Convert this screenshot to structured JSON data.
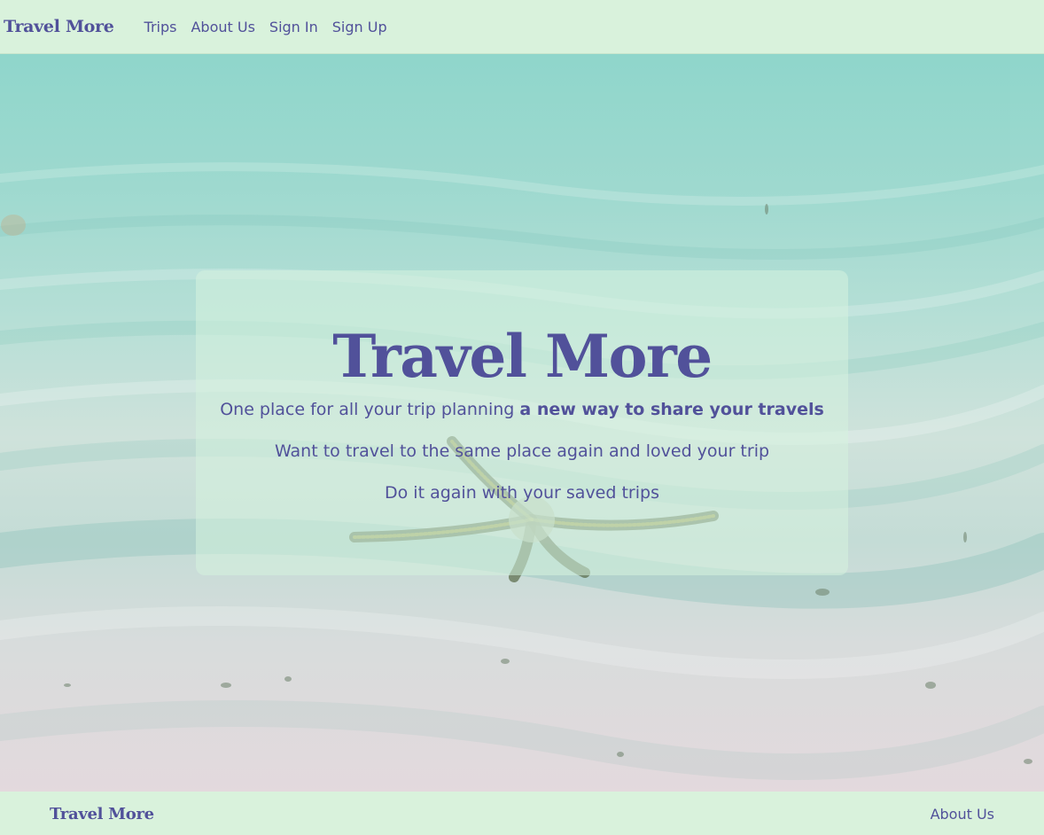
{
  "navbar": {
    "brand": "Travel More",
    "links": [
      "Trips",
      "About Us",
      "Sign In",
      "Sign Up"
    ]
  },
  "hero": {
    "title": "Travel More",
    "line1_normal": "One place for all your trip planning ",
    "line1_bold": "a new way to share your travels",
    "line2": "Want to travel to the same place again and loved your trip",
    "line3": "Do it again with your saved trips",
    "background_image": "underwater-sand-starfish"
  },
  "footer": {
    "brand": "Travel More",
    "link": "About Us"
  },
  "colors": {
    "accent": "#51519a",
    "nav_bg": "#d9f2dc",
    "water": "#8fd6cb",
    "sand": "#e3d9dd"
  }
}
